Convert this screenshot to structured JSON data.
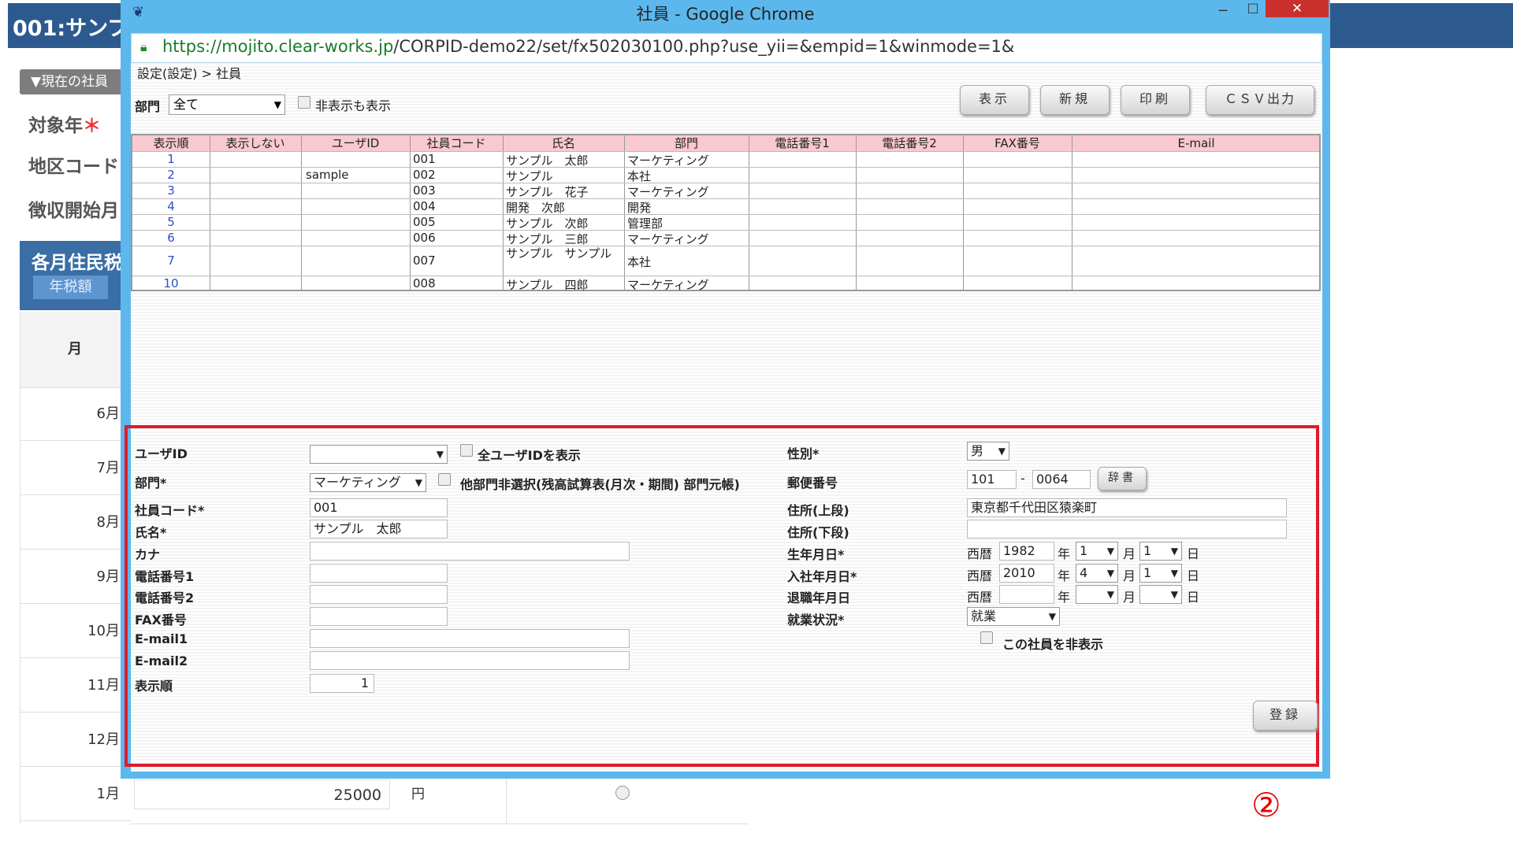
{
  "background": {
    "title": "001:サンプ",
    "current_employee_btn": "▼現在の社員",
    "labels": [
      "対象年",
      "地区コード",
      "徴収開始月"
    ],
    "required_mark": "＊",
    "section_title": "各月住民税",
    "section_tab": "年税額",
    "month_header": "月",
    "months": [
      "6月",
      "7月",
      "8月",
      "9月",
      "10月",
      "11月",
      "12月",
      "1月"
    ],
    "jan_amount": "25000",
    "yen": "円",
    "marker": "②"
  },
  "window": {
    "title": "社員 - Google Chrome",
    "min": "‒",
    "max": "□",
    "close": "✕",
    "url_scheme": "https://",
    "url_host": "mojito.clear-works.jp",
    "url_path": "/CORPID-demo22/set/fx502030100.php?use_yii=&empid=1&winmode=1&"
  },
  "toolbar": {
    "breadcrumb": "設定(設定) > 社員",
    "dept_label": "部門",
    "dept_value": "全て",
    "show_hidden_label": "非表示も表示",
    "buttons": {
      "show": "表示",
      "new": "新規",
      "print": "印刷",
      "csv": "ＣＳＶ出力"
    }
  },
  "table": {
    "headers": [
      "表示順",
      "表示しない",
      "ユーザID",
      "社員コード",
      "氏名",
      "部門",
      "電話番号1",
      "電話番号2",
      "FAX番号",
      "E-mail"
    ],
    "rows": [
      {
        "order": "1",
        "hide": "",
        "user": "",
        "code": "001",
        "name": "サンプル　太郎",
        "dept": "マーケティング"
      },
      {
        "order": "2",
        "hide": "",
        "user": "sample",
        "code": "002",
        "name": "サンプル",
        "dept": "本社"
      },
      {
        "order": "3",
        "hide": "",
        "user": "",
        "code": "003",
        "name": "サンプル　花子",
        "dept": "マーケティング"
      },
      {
        "order": "4",
        "hide": "",
        "user": "",
        "code": "004",
        "name": "開発　次郎",
        "dept": "開発"
      },
      {
        "order": "5",
        "hide": "",
        "user": "",
        "code": "005",
        "name": "サンプル　次郎",
        "dept": "管理部"
      },
      {
        "order": "6",
        "hide": "",
        "user": "",
        "code": "006",
        "name": "サンプル　三郎",
        "dept": "マーケティング"
      },
      {
        "order": "7",
        "hide": "",
        "user": "",
        "code": "007",
        "name": "サンプル　サンプル",
        "dept": "本社"
      },
      {
        "order": "10",
        "hide": "",
        "user": "",
        "code": "008",
        "name": "サンプル　四郎",
        "dept": "マーケティング"
      }
    ]
  },
  "form": {
    "user_id": {
      "label": "ユーザID",
      "value": "",
      "show_all_label": "全ユーザIDを表示"
    },
    "dept": {
      "label": "部門*",
      "value": "マーケティング",
      "note": "他部門非選択(残高試算表(月次・期間) 部門元帳)"
    },
    "code": {
      "label": "社員コード*",
      "value": "001"
    },
    "name": {
      "label": "氏名*",
      "value": "サンプル　太郎"
    },
    "kana": {
      "label": "カナ",
      "value": ""
    },
    "tel1": {
      "label": "電話番号1",
      "value": ""
    },
    "tel2": {
      "label": "電話番号2",
      "value": ""
    },
    "fax": {
      "label": "FAX番号",
      "value": ""
    },
    "email1": {
      "label": "E-mail1",
      "value": ""
    },
    "email2": {
      "label": "E-mail2",
      "value": ""
    },
    "order": {
      "label": "表示順",
      "value": "1"
    },
    "gender": {
      "label": "性別*",
      "value": "男"
    },
    "postal": {
      "label": "郵便番号",
      "value1": "101",
      "sep": "-",
      "value2": "0064",
      "dict_btn": "辞書"
    },
    "addr1": {
      "label": "住所(上段)",
      "value": "東京都千代田区猿楽町"
    },
    "addr2": {
      "label": "住所(下段)",
      "value": ""
    },
    "birth": {
      "label": "生年月日*",
      "era": "西暦",
      "year": "1982",
      "month": "1",
      "day": "1"
    },
    "join": {
      "label": "入社年月日*",
      "era": "西暦",
      "year": "2010",
      "month": "4",
      "day": "1"
    },
    "retire": {
      "label": "退職年月日",
      "era": "西暦",
      "year": "",
      "month": "",
      "day": ""
    },
    "status": {
      "label": "就業状況*",
      "value": "就業"
    },
    "hide_label": "この社員を非表示",
    "unit_year": "年",
    "unit_month": "月",
    "unit_day": "日",
    "register_btn": "登録"
  }
}
